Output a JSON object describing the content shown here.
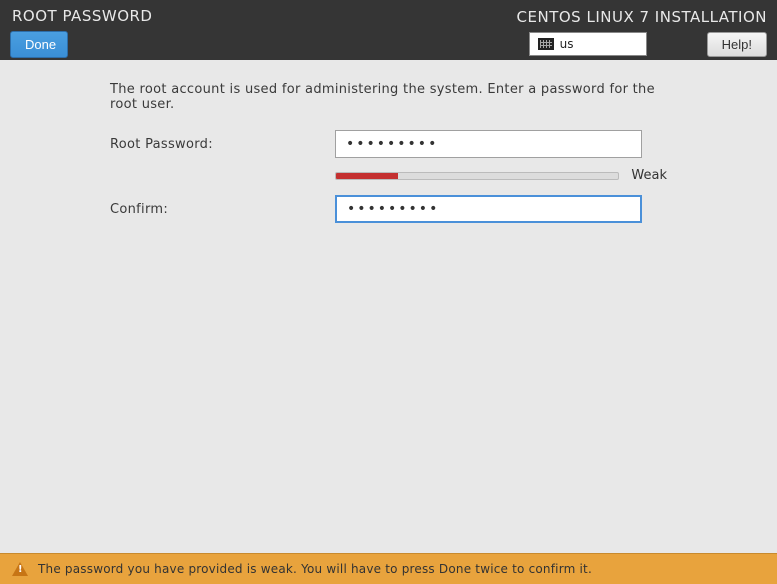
{
  "header": {
    "page_title": "ROOT PASSWORD",
    "done_label": "Done",
    "installer_title": "CENTOS LINUX 7 INSTALLATION",
    "keyboard_layout": "us",
    "help_label": "Help!"
  },
  "form": {
    "description": "The root account is used for administering the system.  Enter a password for the root user.",
    "root_password_label": "Root Password:",
    "root_password_value": "•••••••••",
    "confirm_label": "Confirm:",
    "confirm_value": "•••••••••",
    "strength_label": "Weak",
    "strength_percent": 22,
    "strength_color": "#c43030"
  },
  "warning": {
    "message": "The password you have provided is weak. You will have to press Done twice to confirm it."
  }
}
